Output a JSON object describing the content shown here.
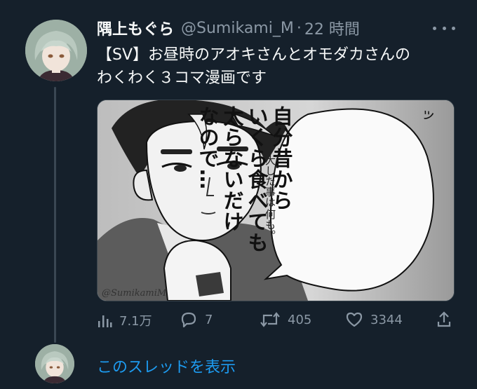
{
  "tweet": {
    "author_name": "隅上もぐら",
    "author_handle": "@Sumikami_M",
    "separator": "·",
    "time_ago": "22 時間",
    "text_lines": [
      "【SV】お昼時のアオキさんとオモダカさんの",
      "わくわく３コマ漫画です"
    ]
  },
  "media": {
    "bubble_columns": [
      "自分昔から",
      "いくら食べても",
      "太らないだけ",
      "なので…"
    ],
    "note_columns": [
      "大した事は",
      "何も。"
    ],
    "sfx": "ッ",
    "watermark": "@SumikamiM"
  },
  "actions": {
    "views": "7.1万",
    "replies": "7",
    "retweets": "405",
    "likes": "3344"
  },
  "thread": {
    "show_thread_label": "このスレッドを表示"
  },
  "colors": {
    "background": "#15202b",
    "text_primary": "#f7f9f9",
    "text_secondary": "#8b98a5",
    "link": "#1d9bf0"
  }
}
